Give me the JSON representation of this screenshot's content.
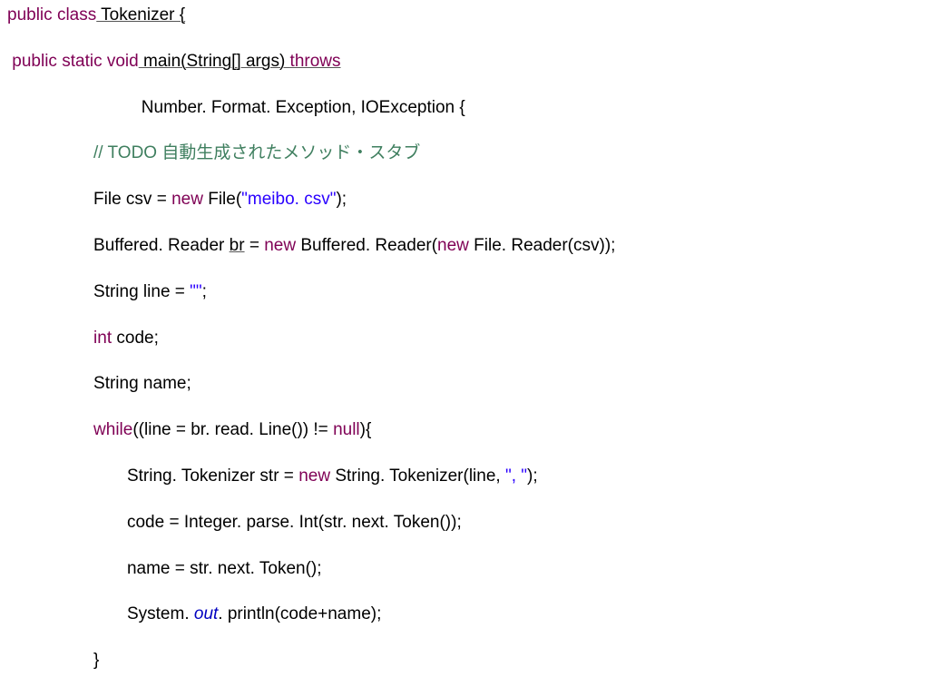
{
  "code": {
    "l1_kw1": "public",
    "l1_kw2": "class",
    "l1_name": " Tokenizer {",
    "l2_kw1": "public",
    "l2_kw2": "static",
    "l2_kw3": "void",
    "l2_mid": " main(String[] args) ",
    "l2_kw4": "throws",
    "l3": "                            Number. Format. Exception, IOException {",
    "l4_pre": "                  ",
    "l4_comment": "// TODO 自動生成されたメソッド・スタブ",
    "l5_pre": "                  File csv = ",
    "l5_kw": "new",
    "l5_mid": " File(",
    "l5_str": "\"meibo. csv\"",
    "l5_end": ");",
    "l6_pre": "                  Buffered. Reader ",
    "l6_var": "br",
    "l6_mid1": " = ",
    "l6_kw1": "new",
    "l6_mid2": " Buffered. Reader(",
    "l6_kw2": "new",
    "l6_mid3": " File. Reader(csv));",
    "l7_pre": "                  String line = ",
    "l7_str": "\"\"",
    "l7_end": ";",
    "l8_pre": "                  ",
    "l8_kw": "int",
    "l8_end": " code;",
    "l9": "                  String name;",
    "l10_pre": "                  ",
    "l10_kw1": "while",
    "l10_mid": "((line = br. read. Line()) != ",
    "l10_kw2": "null",
    "l10_end": "){",
    "l11_pre": "                         String. Tokenizer str = ",
    "l11_kw": "new",
    "l11_mid": " String. Tokenizer(line, ",
    "l11_str": "\", \"",
    "l11_end": ");",
    "l12": "                         code = Integer. parse. Int(str. next. Token());",
    "l13": "                         name = str. next. Token();",
    "l14_pre": "                         System. ",
    "l14_fld": "out",
    "l14_end": ". println(code+name);",
    "l15": "                  }"
  }
}
